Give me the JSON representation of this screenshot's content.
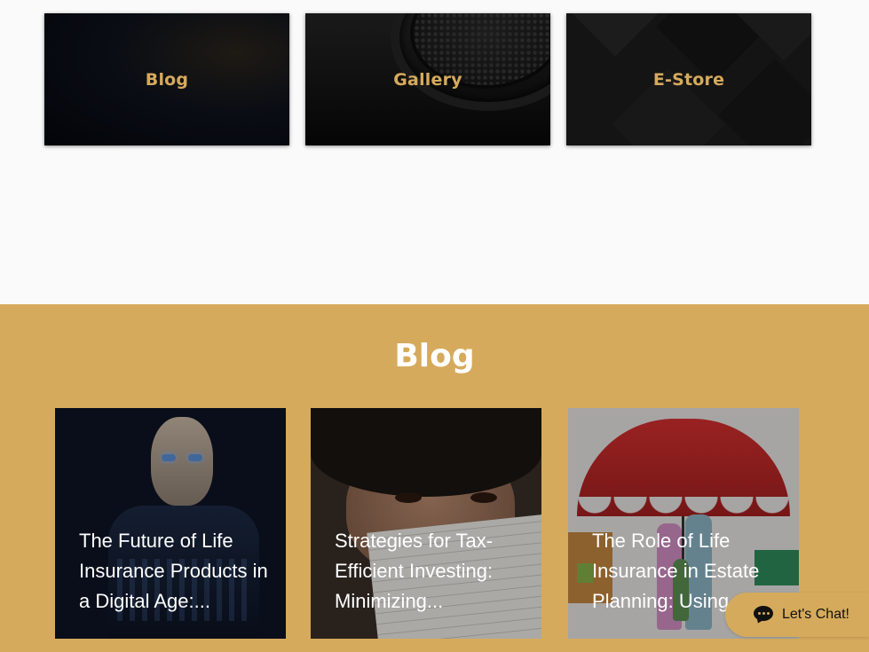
{
  "nav_cards": [
    {
      "label": "Blog"
    },
    {
      "label": "Gallery"
    },
    {
      "label": "E-Store"
    }
  ],
  "blog_section": {
    "title": "Blog",
    "posts": [
      {
        "title": "The Future of Life Insurance Products in a Digital Age:..."
      },
      {
        "title": "Strategies for Tax-Efficient Investing: Minimizing..."
      },
      {
        "title": "The Role of Life Insurance in Estate Planning: Using..."
      }
    ]
  },
  "chat": {
    "label": "Let's Chat!",
    "icon": "chat-bubble-icon"
  },
  "colors": {
    "accent_gold": "#d6aa5c",
    "card_label_gold": "#d6aa5c",
    "page_bg": "#fafafa",
    "text_white": "#ffffff"
  }
}
